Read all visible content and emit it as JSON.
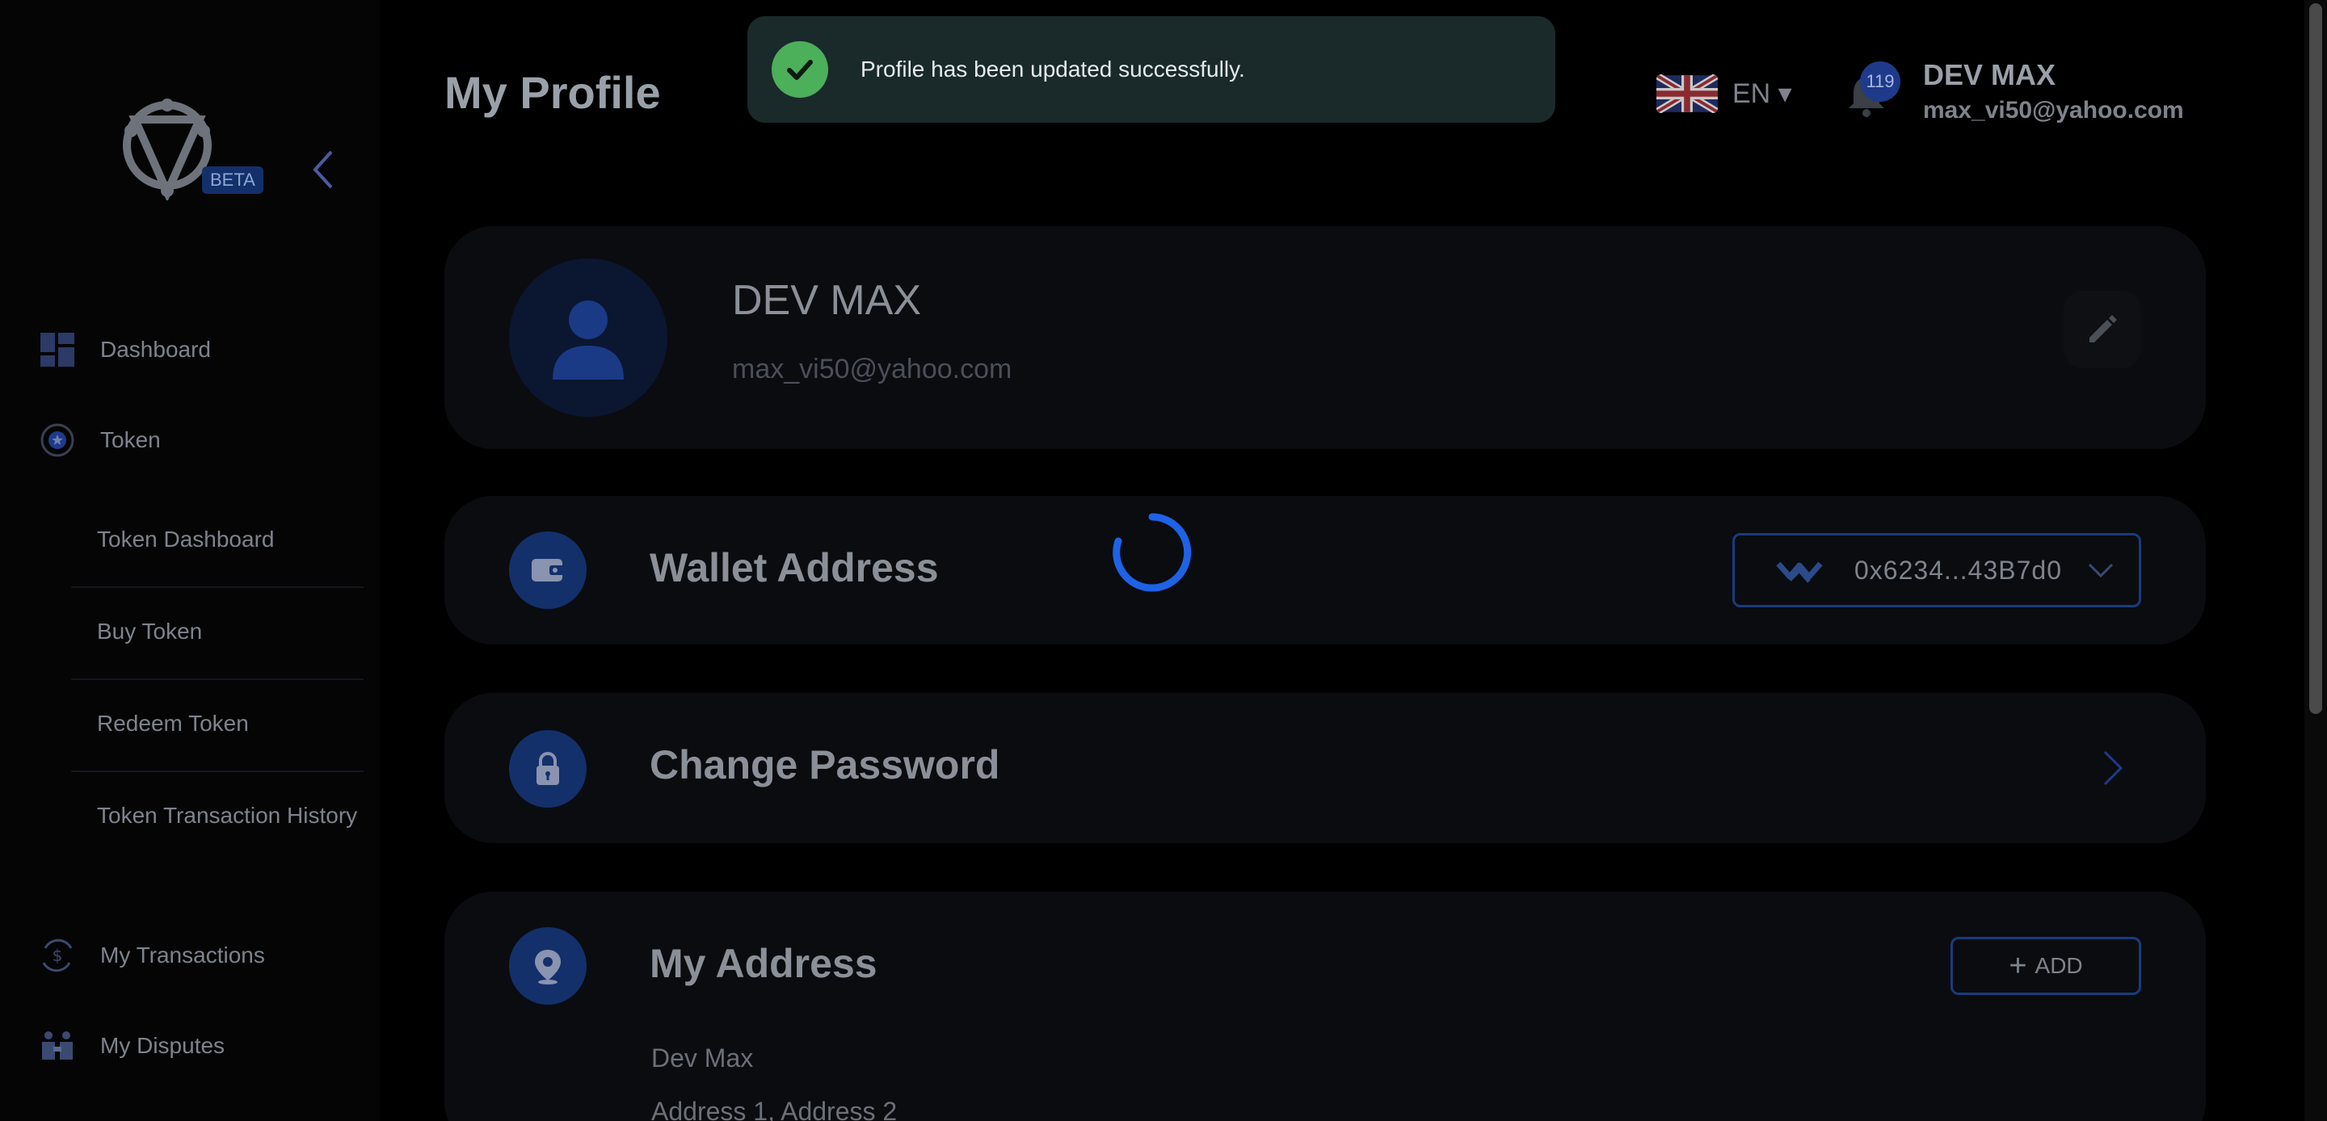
{
  "sidebar": {
    "beta_label": "BETA",
    "items": [
      {
        "label": "Dashboard",
        "icon": "dashboard-icon"
      },
      {
        "label": "Token",
        "icon": "token-icon"
      },
      {
        "label": "My Transactions",
        "icon": "transactions-icon"
      },
      {
        "label": "My Disputes",
        "icon": "disputes-icon"
      }
    ],
    "token_subitems": [
      "Token Dashboard",
      "Buy Token",
      "Redeem Token",
      "Token Transaction History"
    ]
  },
  "header": {
    "title": "My Profile",
    "language": "EN ▾",
    "notification_count": "119",
    "user_name": "DEV MAX",
    "user_email": "max_vi50@yahoo.com"
  },
  "profile": {
    "name": "DEV MAX",
    "email": "max_vi50@yahoo.com"
  },
  "wallet": {
    "title": "Wallet Address",
    "address": "0x6234...43B7d0"
  },
  "password": {
    "title": "Change Password"
  },
  "address_section": {
    "title": "My Address",
    "add_label": "ADD",
    "lines": [
      "Dev Max",
      "Address 1, Address 2"
    ]
  },
  "toast": {
    "message": "Profile has been updated successfully."
  },
  "colors": {
    "accent": "#1a3b7c",
    "success": "#4caf5a",
    "spinner": "#1e62e6"
  }
}
